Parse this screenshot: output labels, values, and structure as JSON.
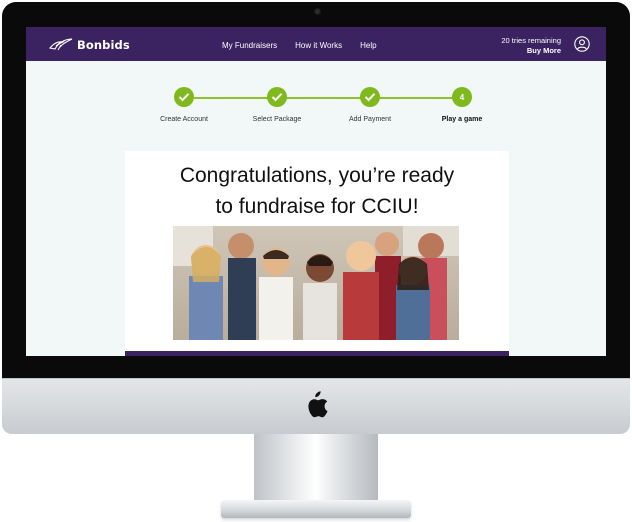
{
  "nav": {
    "logo_text": "Bonbids",
    "links": [
      "My Fundraisers",
      "How it Works",
      "Help"
    ],
    "tries_remaining": "20 tries remaining",
    "buy_more": "Buy More"
  },
  "steps": [
    {
      "label": "Create Account",
      "state": "complete"
    },
    {
      "label": "Select Package",
      "state": "complete"
    },
    {
      "label": "Add Payment",
      "state": "complete"
    },
    {
      "label": "Play a game",
      "state": "current",
      "number": "4"
    }
  ],
  "headline": {
    "line1": "Congratulations, you’re ready",
    "line2": "to fundraise for CCIU!"
  },
  "colors": {
    "brand_purple": "#3b2260",
    "step_green": "#7fb91e",
    "screen_bg": "#f2f8f8"
  },
  "icons": {
    "logo": "bird-logo-icon",
    "account": "user-circle-icon",
    "step_complete": "checkmark-icon",
    "monitor_logo": "apple-logo-icon"
  },
  "hero_image": {
    "subject": "group of smiling schoolchildren with backpacks"
  }
}
